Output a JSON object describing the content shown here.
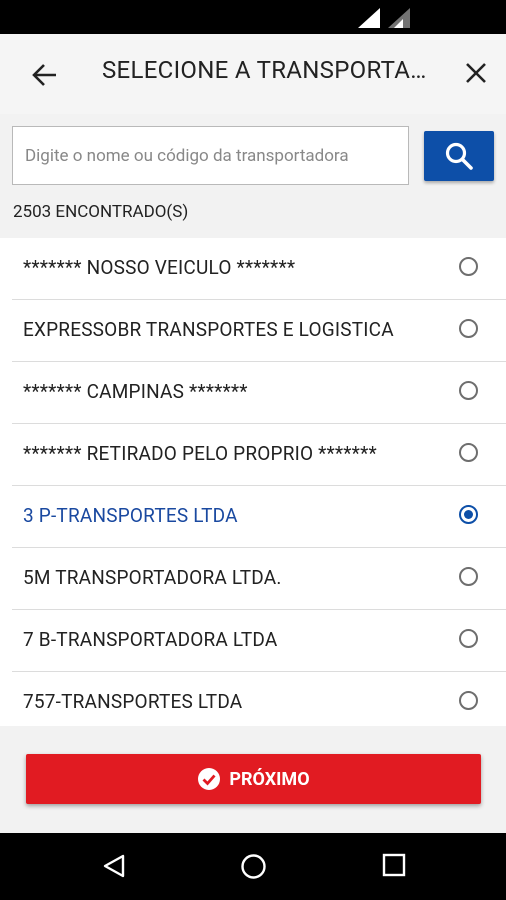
{
  "header": {
    "title": "SELECIONE A TRANSPORTADORA",
    "back_icon": "arrow-left-icon",
    "close_icon": "close-icon"
  },
  "search": {
    "placeholder": "Digite o nome ou código da transportadora",
    "value": "",
    "button_icon": "search-icon"
  },
  "results": {
    "count_label": "2503 ENCONTRADO(S)",
    "items": [
      {
        "label": "******* NOSSO VEICULO *******",
        "selected": false
      },
      {
        "label": "EXPRESSOBR TRANSPORTES E LOGISTICA",
        "selected": false
      },
      {
        "label": "******* CAMPINAS *******",
        "selected": false
      },
      {
        "label": "******* RETIRADO PELO PROPRIO *******",
        "selected": false
      },
      {
        "label": "3 P-TRANSPORTES LTDA",
        "selected": true
      },
      {
        "label": "5M TRANSPORTADORA LTDA.",
        "selected": false
      },
      {
        "label": "7 B-TRANSPORTADORA LTDA",
        "selected": false
      },
      {
        "label": "757-TRANSPORTES LTDA",
        "selected": false
      }
    ]
  },
  "footer": {
    "next_label": "PRÓXIMO",
    "next_icon": "check-circle-icon"
  },
  "colors": {
    "primary_blue": "#0d4fa8",
    "accent_red": "#e11b22",
    "selected_text": "#1a49a0"
  }
}
